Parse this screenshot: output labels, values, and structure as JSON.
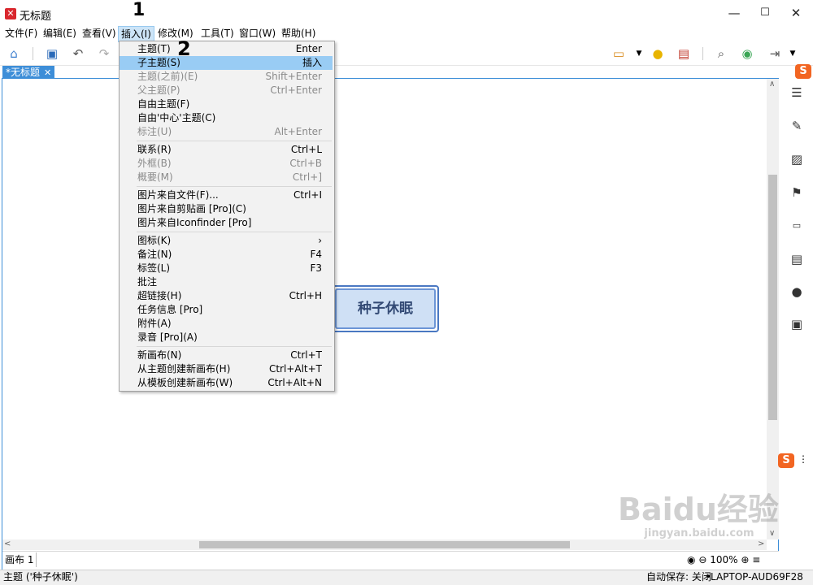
{
  "window": {
    "title": "无标题",
    "controls": [
      "—",
      "☐",
      "✕"
    ]
  },
  "menubar": [
    {
      "label": "文件(F)"
    },
    {
      "label": "编辑(E)"
    },
    {
      "label": "查看(V)"
    },
    {
      "label": "插入(I)",
      "active": true
    },
    {
      "label": "修改(M)"
    },
    {
      "label": "工具(T)"
    },
    {
      "label": "窗口(W)"
    },
    {
      "label": "帮助(H)"
    }
  ],
  "tab": {
    "label": "*无标题",
    "close": "✕"
  },
  "topic": {
    "label": "种子休眠"
  },
  "insert_menu": {
    "groups": [
      [
        {
          "label": "主题(T)",
          "shortcut": "Enter",
          "enabled": true
        },
        {
          "label": "子主题(S)",
          "shortcut": "插入",
          "enabled": true,
          "highlighted": true
        },
        {
          "label": "主题(之前)(E)",
          "shortcut": "Shift+Enter",
          "enabled": false
        },
        {
          "label": "父主题(P)",
          "shortcut": "Ctrl+Enter",
          "enabled": false
        },
        {
          "label": "自由主题(F)",
          "shortcut": "",
          "enabled": true
        },
        {
          "label": "自由'中心'主题(C)",
          "shortcut": "",
          "enabled": true
        },
        {
          "label": "标注(U)",
          "shortcut": "Alt+Enter",
          "enabled": false
        }
      ],
      [
        {
          "label": "联系(R)",
          "shortcut": "Ctrl+L",
          "enabled": true
        },
        {
          "label": "外框(B)",
          "shortcut": "Ctrl+B",
          "enabled": false
        },
        {
          "label": "概要(M)",
          "shortcut": "Ctrl+]",
          "enabled": false
        }
      ],
      [
        {
          "label": "图片来自文件(F)...",
          "shortcut": "Ctrl+I",
          "enabled": true
        },
        {
          "label": "图片来自剪贴画 [Pro](C)",
          "shortcut": "",
          "enabled": true
        },
        {
          "label": "图片来自Iconfinder [Pro]",
          "shortcut": "",
          "enabled": true
        }
      ],
      [
        {
          "label": "图标(K)",
          "shortcut": "›",
          "enabled": true
        },
        {
          "label": "备注(N)",
          "shortcut": "F4",
          "enabled": true
        },
        {
          "label": "标签(L)",
          "shortcut": "F3",
          "enabled": true
        },
        {
          "label": "批注",
          "shortcut": "",
          "enabled": true
        },
        {
          "label": "超链接(H)",
          "shortcut": "Ctrl+H",
          "enabled": true
        },
        {
          "label": "任务信息 [Pro]",
          "shortcut": "",
          "enabled": true
        },
        {
          "label": "附件(A)",
          "shortcut": "",
          "enabled": true
        },
        {
          "label": "录音 [Pro](A)",
          "shortcut": "",
          "enabled": true
        }
      ],
      [
        {
          "label": "新画布(N)",
          "shortcut": "Ctrl+T",
          "enabled": true
        },
        {
          "label": "从主题创建新画布(H)",
          "shortcut": "Ctrl+Alt+T",
          "enabled": true
        },
        {
          "label": "从模板创建新画布(W)",
          "shortcut": "Ctrl+Alt+N",
          "enabled": true
        }
      ]
    ]
  },
  "sheetbar": {
    "sheet_tab": "画布 1",
    "zoom": "100%"
  },
  "statusbar": {
    "left": "主题 ('种子休眠')",
    "autosave": "自动保存: 关闭",
    "host": "LAPTOP-AUD69F28"
  },
  "annotations": {
    "mark1": "1",
    "mark2": "2"
  },
  "watermark": {
    "text1": "Baidu经验",
    "text2": "jingyan.baidu.com"
  },
  "colors": {
    "accent": "#3d8ed8",
    "highlight": "#99ccf4",
    "topic_fill": "#cfe0f5",
    "topic_border": "#4a78c2"
  }
}
